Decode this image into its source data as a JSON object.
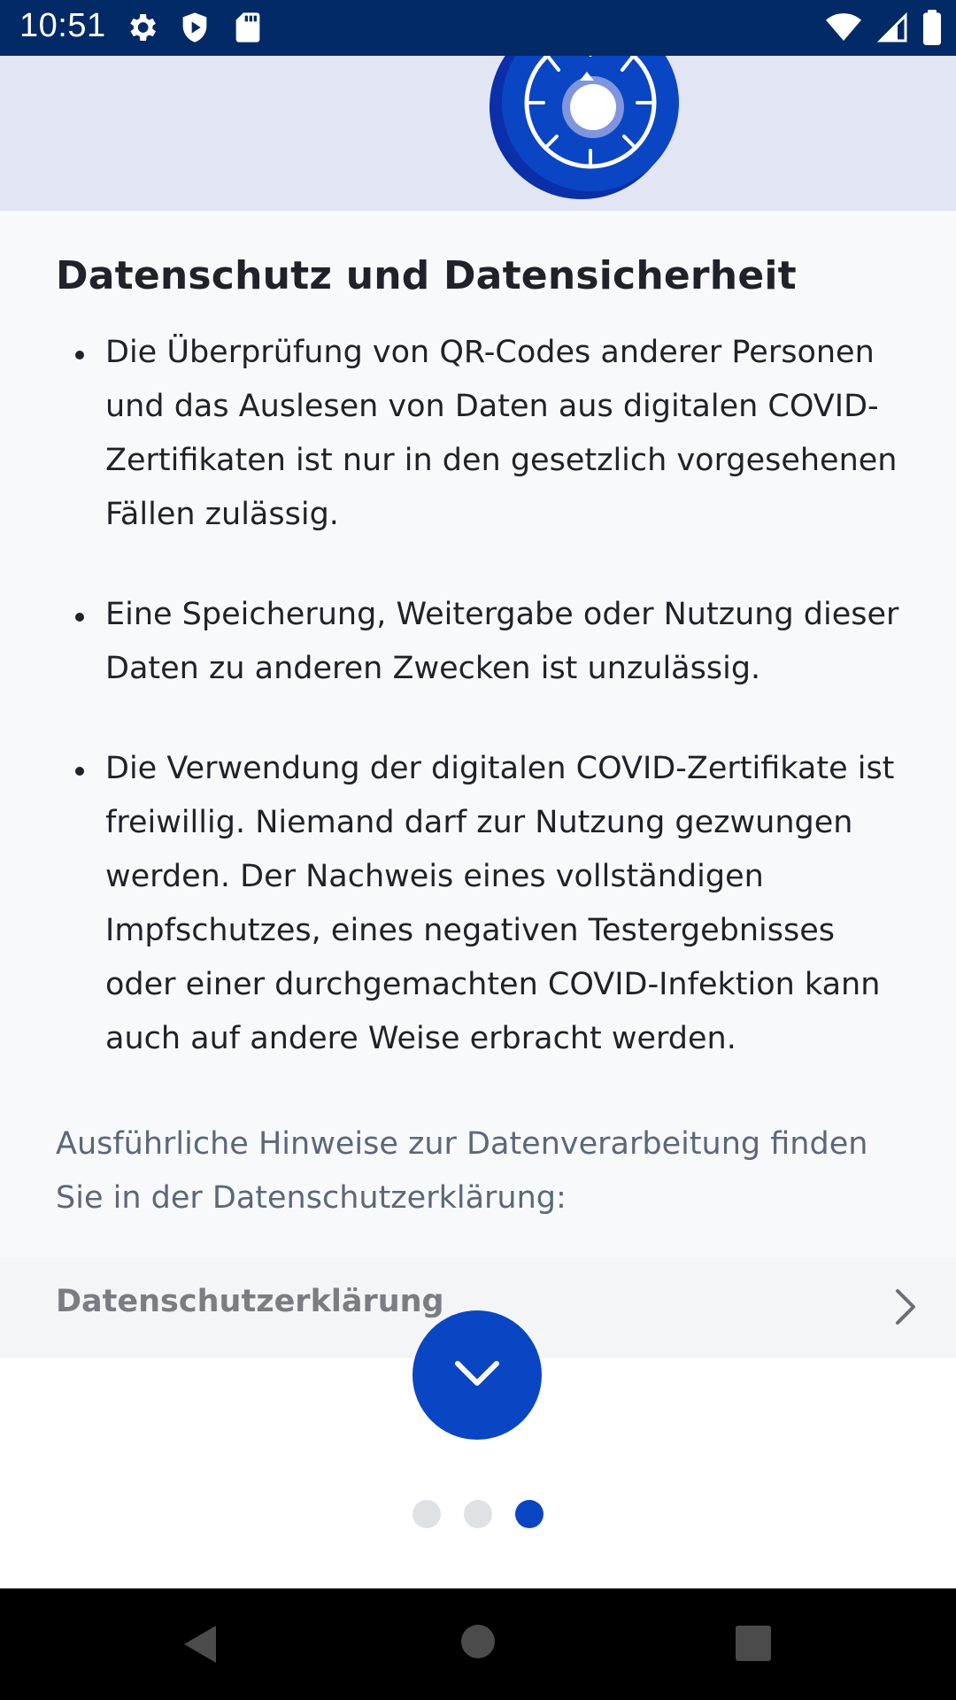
{
  "status_bar": {
    "time": "10:51",
    "icons_left": [
      "settings-icon",
      "shield-play-icon",
      "sd-card-icon"
    ],
    "icons_right": [
      "wifi-icon",
      "signal-icon",
      "battery-icon"
    ]
  },
  "hero": {
    "illustration": "lock-dial-icon",
    "color": "#0a46c3"
  },
  "main": {
    "title": "Datenschutz und Datensicherheit",
    "bullets": [
      "Die Überprüfung von QR-Codes anderer Personen und das Auslesen von Daten aus digitalen COVID-Zertifikaten ist nur in den gesetzlich vorgesehenen Fällen zulässig.",
      "Eine Speicherung, Weitergabe oder Nutzung dieser Daten zu anderen Zwecken ist unzulässig.",
      "Die Verwendung der digitalen COVID-Zertifikate ist freiwillig. Niemand darf zur Nutzung gezwungen werden. Der Nachweis eines vollständigen Impfschutzes, eines negativen Testergebnisses oder einer durchgemachten COVID-Infektion kann auch auf andere Weise erbracht werden."
    ],
    "hint": "Ausführliche Hinweise zur Datenverarbeitung finden Sie in der Datenschutzerklärung:"
  },
  "link": {
    "label": "Datenschutzerklärung",
    "icon": "chevron-right-icon"
  },
  "scroll_button": {
    "icon": "chevron-down-icon"
  },
  "pager": {
    "pages": 3,
    "active_index": 2
  },
  "nav_bar": {
    "buttons": [
      "back-icon",
      "home-icon",
      "recents-icon"
    ]
  },
  "colors": {
    "status_bar": "#012a66",
    "accent": "#0a46c3",
    "hero_background": "#e2e5f4",
    "page_background": "#f8f9fb"
  }
}
